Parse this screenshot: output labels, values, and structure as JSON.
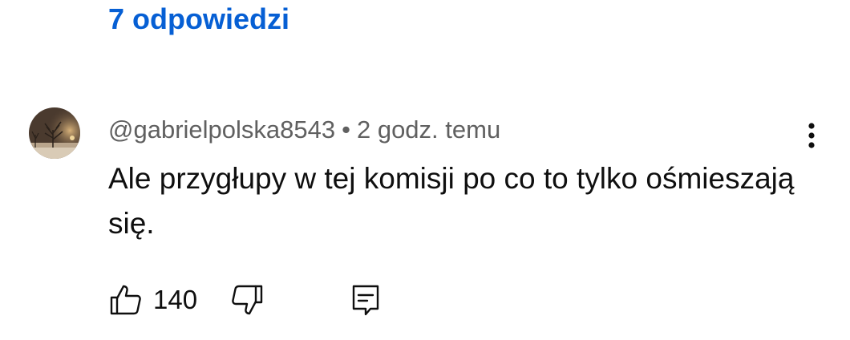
{
  "replies": {
    "label": "7 odpowiedzi"
  },
  "comment": {
    "author": "@gabrielpolska8543",
    "separator": "•",
    "time": "2 godz. temu",
    "text": "Ale przygłupy w tej komisji po co to tylko ośmieszają się.",
    "likes": "140",
    "avatar_icon": "avatar-snowy-night-tree",
    "more_icon": "more-vertical-icon",
    "like_icon": "thumbs-up-icon",
    "dislike_icon": "thumbs-down-icon",
    "reply_icon": "reply-comment-icon"
  },
  "colors": {
    "link": "#065fd4",
    "meta": "#606060",
    "text": "#0f0f0f"
  }
}
